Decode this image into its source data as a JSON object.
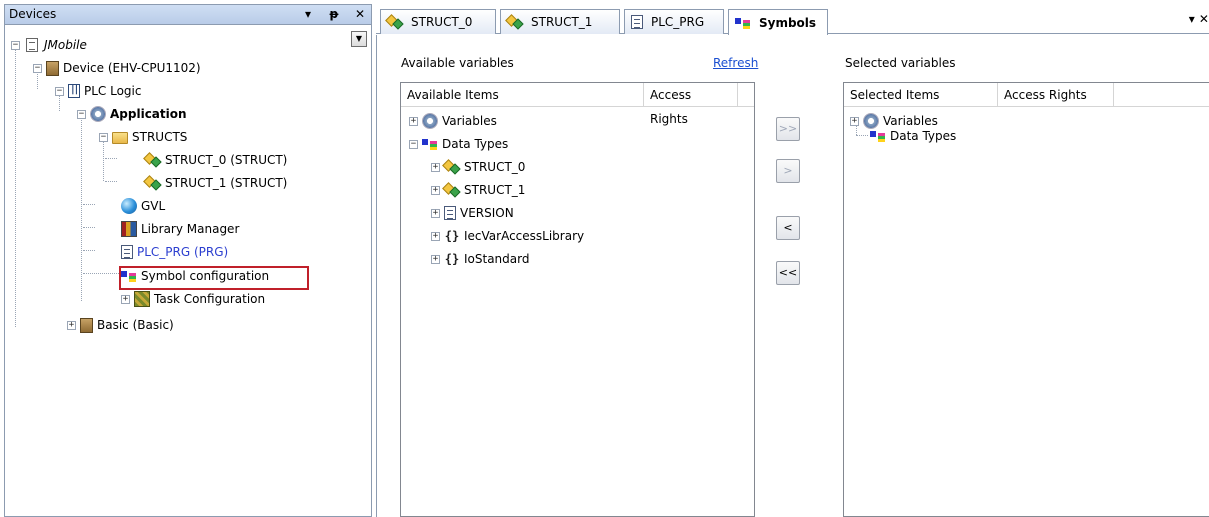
{
  "devices": {
    "title": "Devices",
    "header_buttons": [
      "▾",
      "ᵽ",
      "✕"
    ],
    "tree": {
      "root": "JMobile",
      "device": "Device (EHV-CPU1102)",
      "plc_logic": "PLC Logic",
      "application": "Application",
      "structs": "STRUCTS",
      "struct0": "STRUCT_0 (STRUCT)",
      "struct1": "STRUCT_1 (STRUCT)",
      "gvl": "GVL",
      "library_manager": "Library Manager",
      "plc_prg": "PLC_PRG (PRG)",
      "symbol_configuration": "Symbol configuration",
      "task_configuration": "Task Configuration",
      "basic": "Basic (Basic)"
    },
    "highlight_color": "#c0202a"
  },
  "editor": {
    "tabs": [
      {
        "label": "STRUCT_0",
        "icon": "struct-icon"
      },
      {
        "label": "STRUCT_1",
        "icon": "struct-icon"
      },
      {
        "label": "PLC_PRG",
        "icon": "program-icon"
      },
      {
        "label": "Symbols",
        "icon": "symbol-icon",
        "active": true
      }
    ],
    "tab_menu": "▾ ✕",
    "available": {
      "label": "Available variables",
      "refresh": "Refresh",
      "columns": [
        "Available Items",
        "Access Rights"
      ],
      "items": {
        "variables": "Variables",
        "data_types": "Data Types",
        "struct0": "STRUCT_0",
        "struct1": "STRUCT_1",
        "version": "VERSION",
        "iecvar": "IecVarAccessLibrary",
        "iostandard": "IoStandard"
      }
    },
    "buttons": {
      "add_all": ">>",
      "add": ">",
      "remove": "<",
      "remove_all": "<<"
    },
    "selected": {
      "label": "Selected variables",
      "columns": [
        "Selected Items",
        "Access Rights"
      ],
      "items": {
        "variables": "Variables",
        "data_types": "Data Types"
      }
    },
    "link_color": "#1a4fd1"
  }
}
